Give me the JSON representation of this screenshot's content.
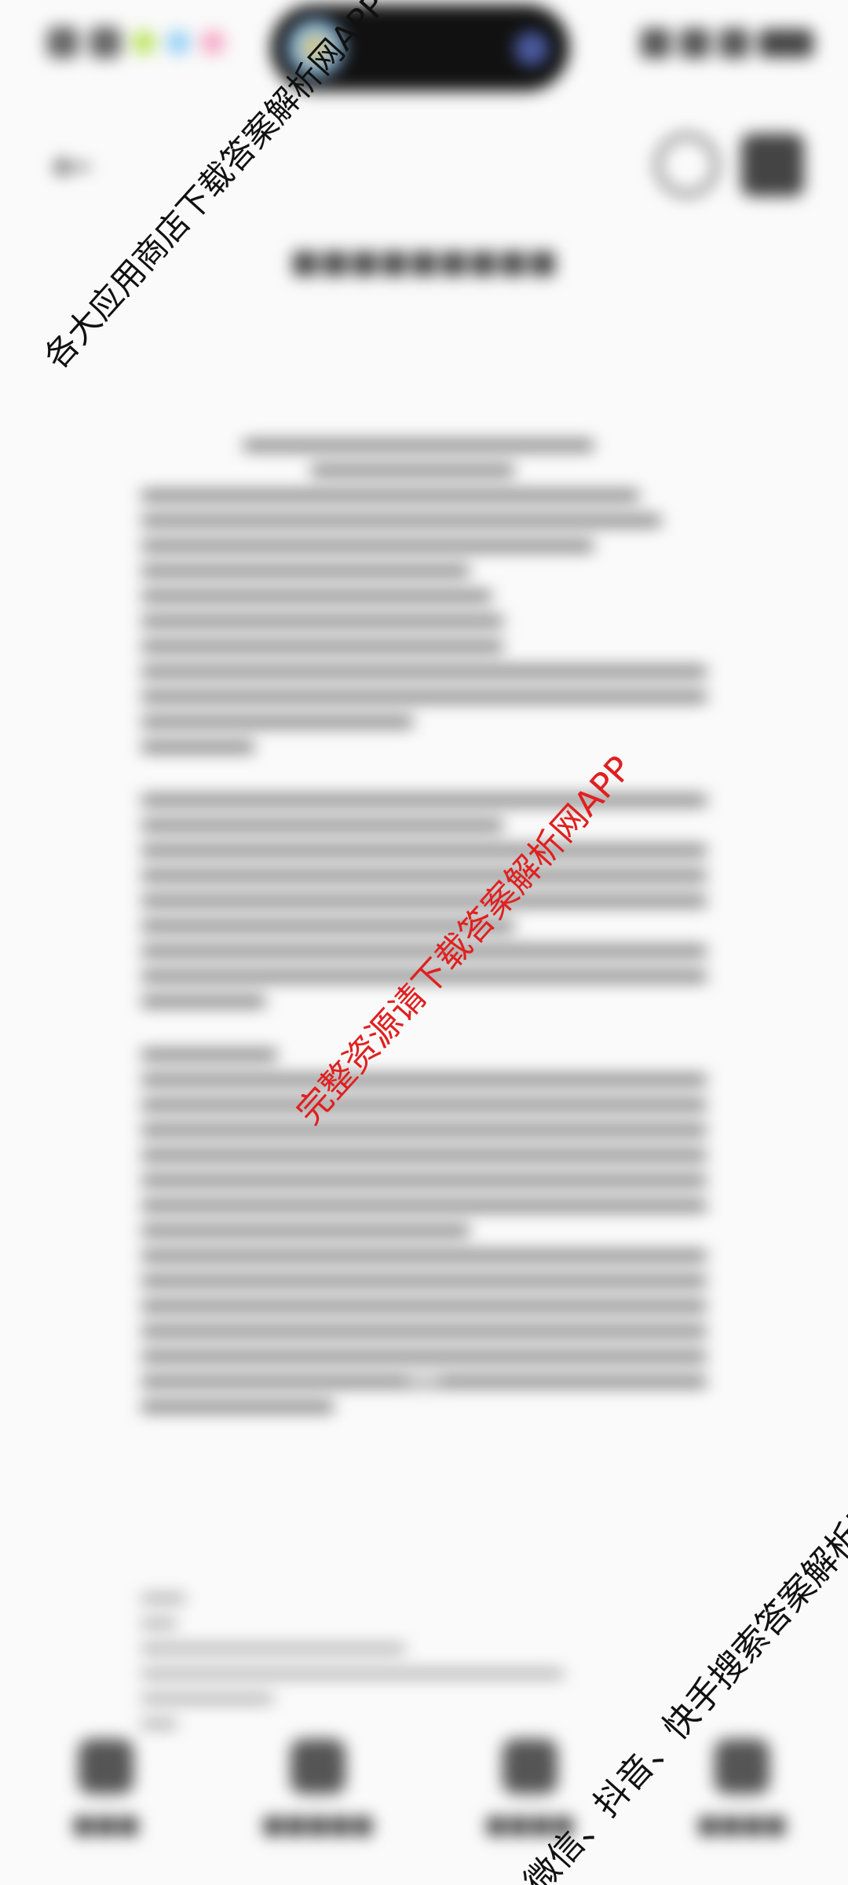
{
  "watermarks": {
    "top": "各大应用商店下载答案解析网APP",
    "middle": "完整资源请下载答案解析网APP",
    "bottom": "微信、抖音、快手搜索答案解析网"
  },
  "colors": {
    "watermark_middle": "#e02020",
    "watermark_dark": "#111111",
    "background": "#fafafa"
  },
  "icons": {
    "back": "back-arrow-icon",
    "clock": "clock-icon",
    "grid": "grid-icon"
  }
}
